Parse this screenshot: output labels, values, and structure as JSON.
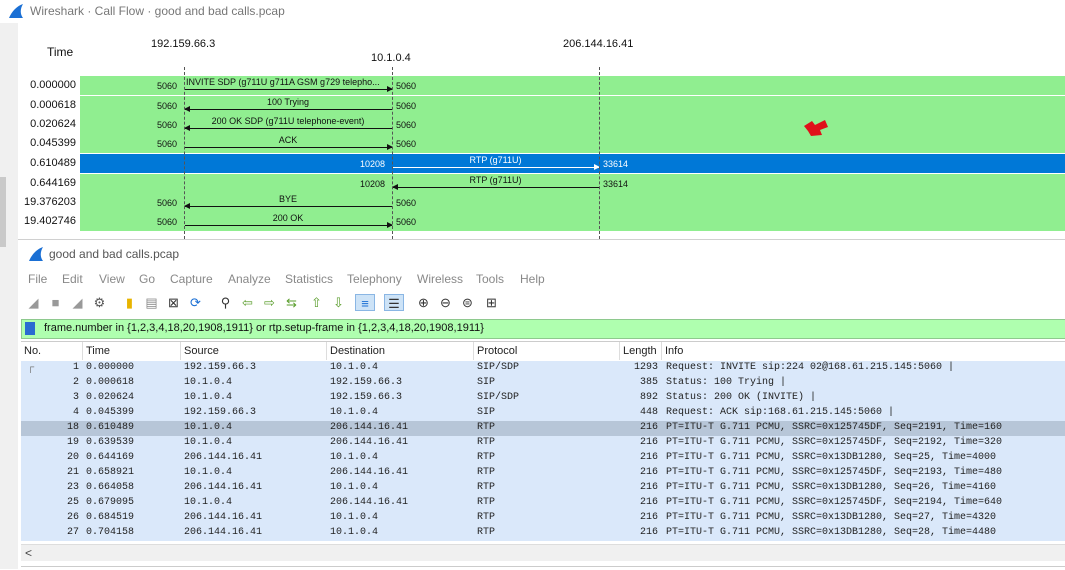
{
  "flow_window": {
    "title": "Wireshark · Call Flow · good and bad calls.pcap",
    "time_header": "Time",
    "hosts": [
      "192.159.66.3",
      "10.1.0.4",
      "206.144.16.41"
    ],
    "rows": [
      {
        "time": "0.000000",
        "left_port": "5060",
        "right_port": "5060",
        "label": "INVITE SDP (g711U g711A GSM g729 telepho..."
      },
      {
        "time": "0.000618",
        "left_port": "5060",
        "right_port": "5060",
        "label": "100 Trying"
      },
      {
        "time": "0.020624",
        "left_port": "5060",
        "right_port": "5060",
        "label": "200 OK SDP (g711U telephone-event)"
      },
      {
        "time": "0.045399",
        "left_port": "5060",
        "right_port": "5060",
        "label": "ACK"
      },
      {
        "time": "0.610489",
        "left_port": "10208",
        "right_port": "33614",
        "label": "RTP (g711U)"
      },
      {
        "time": "0.644169",
        "left_port": "10208",
        "right_port": "33614",
        "label": "RTP (g711U)"
      },
      {
        "time": "19.376203",
        "left_port": "5060",
        "right_port": "5060",
        "label": "BYE"
      },
      {
        "time": "19.402746",
        "left_port": "5060",
        "right_port": "5060",
        "label": "200 OK"
      }
    ]
  },
  "main_window": {
    "title": "good and bad calls.pcap",
    "menu": [
      "File",
      "Edit",
      "View",
      "Go",
      "Capture",
      "Analyze",
      "Statistics",
      "Telephony",
      "Wireless",
      "Tools",
      "Help"
    ],
    "filter": "frame.number in {1,2,3,4,18,20,1908,1911} or rtp.setup-frame in {1,2,3,4,18,20,1908,1911}",
    "columns": [
      "No.",
      "Time",
      "Source",
      "Destination",
      "Protocol",
      "Length",
      "Info"
    ],
    "packets": [
      {
        "no": "1",
        "time": "0.000000",
        "src": "192.159.66.3",
        "dst": "10.1.0.4",
        "proto": "SIP/SDP",
        "len": "1293",
        "info": "Request: INVITE sip:224      02@168.61.215.145:5060 |"
      },
      {
        "no": "2",
        "time": "0.000618",
        "src": "10.1.0.4",
        "dst": "192.159.66.3",
        "proto": "SIP",
        "len": "385",
        "info": "Status: 100 Trying |"
      },
      {
        "no": "3",
        "time": "0.020624",
        "src": "10.1.0.4",
        "dst": "192.159.66.3",
        "proto": "SIP/SDP",
        "len": "892",
        "info": "Status: 200 OK (INVITE) |"
      },
      {
        "no": "4",
        "time": "0.045399",
        "src": "192.159.66.3",
        "dst": "10.1.0.4",
        "proto": "SIP",
        "len": "448",
        "info": "Request: ACK sip:168.61.215.145:5060 |"
      },
      {
        "no": "18",
        "time": "0.610489",
        "src": "10.1.0.4",
        "dst": "206.144.16.41",
        "proto": "RTP",
        "len": "216",
        "info": "PT=ITU-T G.711 PCMU, SSRC=0x125745DF, Seq=2191, Time=160"
      },
      {
        "no": "19",
        "time": "0.639539",
        "src": "10.1.0.4",
        "dst": "206.144.16.41",
        "proto": "RTP",
        "len": "216",
        "info": "PT=ITU-T G.711 PCMU, SSRC=0x125745DF, Seq=2192, Time=320"
      },
      {
        "no": "20",
        "time": "0.644169",
        "src": "206.144.16.41",
        "dst": "10.1.0.4",
        "proto": "RTP",
        "len": "216",
        "info": "PT=ITU-T G.711 PCMU, SSRC=0x13DB1280, Seq=25, Time=4000"
      },
      {
        "no": "21",
        "time": "0.658921",
        "src": "10.1.0.4",
        "dst": "206.144.16.41",
        "proto": "RTP",
        "len": "216",
        "info": "PT=ITU-T G.711 PCMU, SSRC=0x125745DF, Seq=2193, Time=480"
      },
      {
        "no": "23",
        "time": "0.664058",
        "src": "206.144.16.41",
        "dst": "10.1.0.4",
        "proto": "RTP",
        "len": "216",
        "info": "PT=ITU-T G.711 PCMU, SSRC=0x13DB1280, Seq=26, Time=4160"
      },
      {
        "no": "25",
        "time": "0.679095",
        "src": "10.1.0.4",
        "dst": "206.144.16.41",
        "proto": "RTP",
        "len": "216",
        "info": "PT=ITU-T G.711 PCMU, SSRC=0x125745DF, Seq=2194, Time=640"
      },
      {
        "no": "26",
        "time": "0.684519",
        "src": "206.144.16.41",
        "dst": "10.1.0.4",
        "proto": "RTP",
        "len": "216",
        "info": "PT=ITU-T G.711 PCMU, SSRC=0x13DB1280, Seq=27, Time=4320"
      },
      {
        "no": "27",
        "time": "0.704158",
        "src": "206.144.16.41",
        "dst": "10.1.0.4",
        "proto": "RTP",
        "len": "216",
        "info": "PT=ITU-T G.711 PCMU, SSRC=0x13DB1280, Seq=28, Time=4480"
      }
    ]
  },
  "colors": {
    "flow_row": "#90ee90",
    "flow_selected": "#0078d7",
    "packet_row": "#dae8fa",
    "packet_selected": "#b7c6d8",
    "filter_bg": "#afffaf"
  }
}
